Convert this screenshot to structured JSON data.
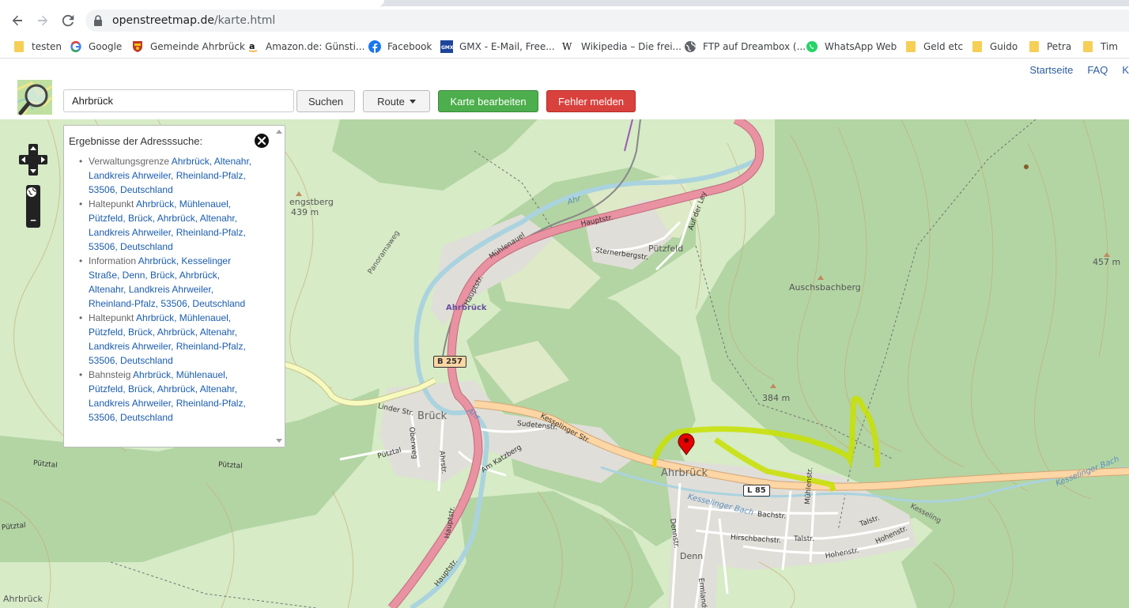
{
  "browser": {
    "url_host": "openstreetmap.de",
    "url_path": "/karte.html"
  },
  "bookmarks": [
    {
      "label": "testen",
      "icon": "folder-icon"
    },
    {
      "label": "Google",
      "icon": "google-icon"
    },
    {
      "label": "Gemeinde Ahrbrück",
      "icon": "crest-icon"
    },
    {
      "label": "Amazon.de: Günsti...",
      "icon": "amazon-icon"
    },
    {
      "label": "Facebook",
      "icon": "facebook-icon"
    },
    {
      "label": "GMX - E-Mail, Free...",
      "icon": "gmx-icon"
    },
    {
      "label": "Wikipedia – Die frei...",
      "icon": "wikipedia-icon"
    },
    {
      "label": "FTP auf Dreambox (...",
      "icon": "globe-icon"
    },
    {
      "label": "WhatsApp Web",
      "icon": "whatsapp-icon"
    },
    {
      "label": "Geld etc",
      "icon": "folder-icon"
    },
    {
      "label": "Guido",
      "icon": "folder-icon"
    },
    {
      "label": "Petra",
      "icon": "folder-icon"
    },
    {
      "label": "Tim",
      "icon": "folder-icon"
    }
  ],
  "header": {
    "links": [
      "Startseite",
      "FAQ",
      "K"
    ],
    "search_value": "Ahrbrück",
    "search_button": "Suchen",
    "route_button": "Route",
    "edit_button": "Karte bearbeiten",
    "report_button": "Fehler melden"
  },
  "results": {
    "title": "Ergebnisse der Adresssuche:",
    "items": [
      {
        "type": "Verwaltungsgrenze",
        "text": "Ahrbrück, Altenahr, Landkreis Ahrweiler, Rheinland-Pfalz, 53506, Deutschland"
      },
      {
        "type": "Haltepunkt",
        "text": "Ahrbrück, Mühlenauel, Pützfeld, Brück, Ahrbrück, Altenahr, Landkreis Ahrweiler, Rheinland-Pfalz, 53506, Deutschland"
      },
      {
        "type": "Information",
        "text": "Ahrbrück, Kesselinger Straße, Denn, Brück, Ahrbrück, Altenahr, Landkreis Ahrweiler, Rheinland-Pfalz, 53506, Deutschland"
      },
      {
        "type": "Haltepunkt",
        "text": "Ahrbrück, Mühlenauel, Pützfeld, Brück, Ahrbrück, Altenahr, Landkreis Ahrweiler, Rheinland-Pfalz, 53506, Deutschland"
      },
      {
        "type": "Bahnsteig",
        "text": "Ahrbrück, Mühlenauel, Pützfeld, Brück, Ahrbrück, Altenahr, Landkreis Ahrweiler, Rheinland-Pfalz, 53506, Deutschland"
      }
    ]
  },
  "map": {
    "places": {
      "ahrbrueck": "Ahrbrück",
      "brueck": "Brück",
      "puetzfeld": "Pützfeld",
      "denn": "Denn",
      "ahrbrueck_station": "Ahrbrück",
      "ahrbrueck_edge": "Ahrbrück"
    },
    "peaks": {
      "auschsbachberg": "Auschsbachberg",
      "p384": "384 m",
      "p457": "457 m",
      "engstberg": "engstberg",
      "p439": "439 m"
    },
    "roads": {
      "b257": "B 257",
      "l85": "L 85"
    },
    "streets": {
      "hauptstr1": "Hauptstr.",
      "hauptstr2": "Hauptstr.",
      "hauptstr3": "Hauptstr.",
      "hauptstr4": "Hauptstr.",
      "kesselinger": "Kesselinger Str.",
      "muehlenauel": "Mühlenauel",
      "sternerbergstr": "Sternerbergstr.",
      "auf_der_ley": "Auf der Ley",
      "panoramaweg": "Panoramaweg",
      "linder_str": "Linder Str.",
      "sudetenstr": "Sudetenstr.",
      "am_katzberg": "Am Katzberg",
      "puetztal1": "Pützt­al",
      "puetztal2": "Pützt­al",
      "puetztal3": "Pützt­al",
      "oberweg": "Oberweg",
      "puetztal4": "Pützt­al",
      "ahrstr": "Ahrstr.",
      "dennstr": "Dennstr.",
      "bachstr": "Bachstr.",
      "hirschbachstr": "Hirschbachstr.",
      "talstr1": "Talstr.",
      "talstr2": "Talstr.",
      "muehlenstr": "Mühlenstr.",
      "hohenstr1": "Hohenstr.",
      "hohenstr2": "Hohenstr.",
      "ermlandstr": "Ermlandstr.",
      "kesseling": "Kesseling"
    },
    "water": {
      "ahr1": "Ahr",
      "ahr2": "Ahr",
      "kesselinger_bach": "Kesselinger Bach",
      "kesselinger_bach2": "Kesselinger Bach"
    },
    "colors": {
      "land": "#d6ebc6",
      "forest": "#add19e",
      "water": "#aad3df",
      "primary_road": "#e892a2",
      "secondary_road": "#fcd6a4",
      "tertiary_road": "#f7fabf",
      "highlight": "#c8e000"
    }
  }
}
